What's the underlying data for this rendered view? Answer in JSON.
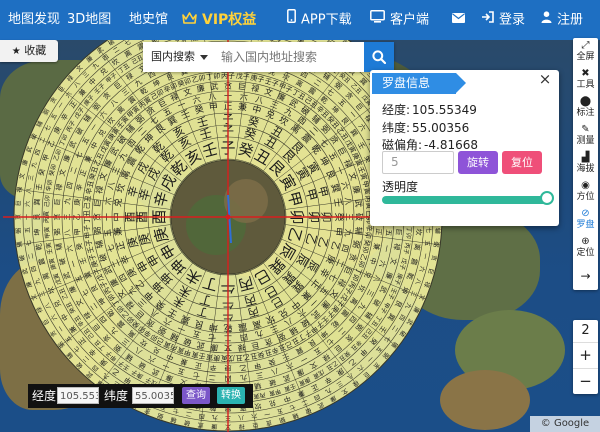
{
  "nav": {
    "map_discover": "地图发现",
    "map_3d": "3D地图",
    "history": "地史馆",
    "vip": "VIP权益",
    "app_download": "APP下载",
    "client": "客户端",
    "login": "登录",
    "register": "注册"
  },
  "favorites": {
    "label": "收藏"
  },
  "search": {
    "type": "国内搜索",
    "placeholder": "输入国内地址搜索"
  },
  "toolbar": {
    "items": [
      {
        "label": "全屏",
        "icon": "fullscreen-icon"
      },
      {
        "label": "工具",
        "icon": "toolbox-icon"
      },
      {
        "label": "标注",
        "icon": "marker-icon"
      },
      {
        "label": "测量",
        "icon": "ruler-icon"
      },
      {
        "label": "海拔",
        "icon": "elevation-icon"
      },
      {
        "label": "方位",
        "icon": "direction-icon"
      },
      {
        "label": "罗盘",
        "icon": "compass-icon",
        "active": true
      },
      {
        "label": "定位",
        "icon": "locate-icon"
      }
    ],
    "collapse_icon": "arrow-right-icon"
  },
  "zoom": {
    "level": "2",
    "plus": "+",
    "minus": "−"
  },
  "panel": {
    "title": "罗盘信息",
    "longitude_label": "经度:",
    "longitude": "105.55349",
    "latitude_label": "纬度:",
    "latitude": "55.00356",
    "declination_label": "磁偏角:",
    "declination": "-4.81668",
    "angle_value": "5",
    "rotate": "旋转",
    "reset": "复位",
    "opacity_label": "透明度",
    "opacity": 1.0
  },
  "coordbar": {
    "lng_label": "经度",
    "lng_value": "105.553",
    "lat_label": "纬度",
    "lat_value": "55.0035",
    "query": "查询",
    "convert": "转换"
  },
  "attribution": "© Google Maps",
  "compass": {
    "dial_mountains": [
      "子",
      "癸",
      "丑",
      "艮",
      "寅",
      "甲",
      "卯",
      "乙",
      "辰",
      "巽",
      "巳",
      "丙",
      "午",
      "丁",
      "未",
      "坤",
      "申",
      "庚",
      "酉",
      "辛",
      "戌",
      "乾",
      "亥",
      "壬"
    ],
    "ring_a": [
      "丙子",
      "戊子",
      "庚子",
      "壬子",
      "甲子",
      "丁丑",
      "己丑",
      "辛丑",
      "癸丑",
      "乙丑",
      "戊寅",
      "庚寅",
      "壬寅",
      "甲寅",
      "丙寅",
      "己卯",
      "辛卯",
      "癸卯",
      "乙卯",
      "丁卯"
    ],
    "ring_b": [
      "一",
      "六",
      "八",
      "三",
      "九",
      "四",
      "二",
      "七",
      "五"
    ],
    "ring_c": [
      "贪",
      "巨",
      "禄",
      "文",
      "廉",
      "武",
      "破",
      "辅",
      "弼"
    ],
    "ring_d": [
      "正",
      "兼",
      "中",
      "兑",
      "坎",
      "离",
      "震",
      "乾",
      "坤",
      "艮",
      "巽",
      "壬",
      "癸",
      "甲",
      "乙",
      "庚",
      "辛"
    ],
    "colors": {
      "face": "#ecec9a",
      "line": "#3a3a2a",
      "red": "#d81e1e",
      "text": "#1b1b1b"
    }
  },
  "colors": {
    "nav": "#1e6fc2",
    "vip": "#ffd23a",
    "rotate": "#8e54d8",
    "reset": "#ef4f79",
    "slider": "#2fb89a",
    "query": "#7b57c8",
    "convert": "#2bb3b1"
  }
}
